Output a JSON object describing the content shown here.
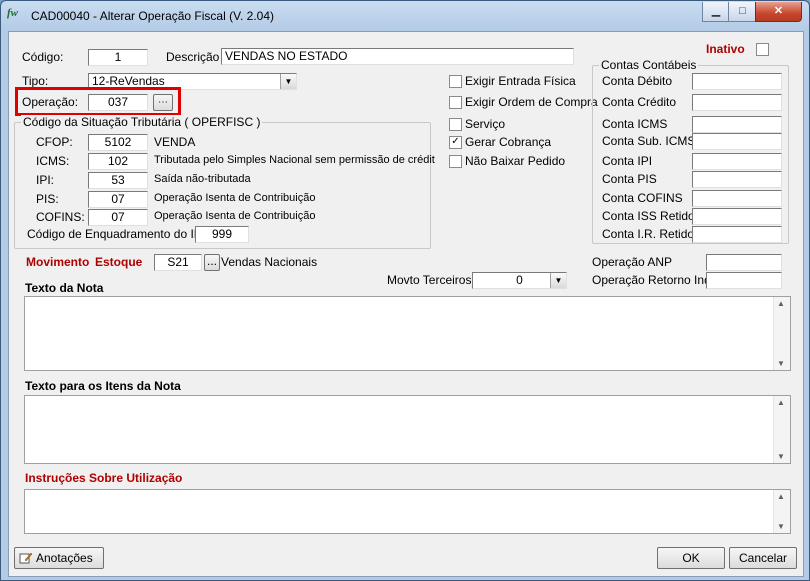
{
  "window": {
    "icon_text": "fw",
    "title": "CAD00040 - Alterar Operação Fiscal (V. 2.04)",
    "minimize": "▁",
    "maximize": "□",
    "close": "✕"
  },
  "header": {
    "codigo_label": "Código:",
    "codigo_value": "1",
    "descricao_label": "Descrição",
    "descricao_value": "VENDAS NO ESTADO",
    "inativo_label": "Inativo",
    "tipo_label": "Tipo:",
    "tipo_value": "12-ReVendas",
    "operacao_label": "Operação:",
    "operacao_value": "037",
    "operacao_btn": "⋯"
  },
  "options": {
    "exigir_entrada": "Exigir Entrada Física",
    "exigir_ordem": "Exigir Ordem de Compra",
    "servico": "Serviço",
    "gerar_cobranca": "Gerar Cobrança",
    "nao_baixar": "Não Baixar Pedido",
    "gerar_cobranca_checked": "✓"
  },
  "tributaria": {
    "title": "Código da Situação Tributária ( OPERFISC )",
    "cfop_label": "CFOP:",
    "cfop_value": "5102",
    "cfop_desc": "VENDA",
    "icms_label": "ICMS:",
    "icms_value": "102",
    "icms_desc": "Tributada pelo Simples Nacional sem permissão de crédit",
    "ipi_label": "IPI:",
    "ipi_value": "53",
    "ipi_desc": "Saída não-tributada",
    "pis_label": "PIS:",
    "pis_value": "07",
    "pis_desc": "Operação Isenta de Contribuição",
    "cofins_label": "COFINS:",
    "cofins_value": "07",
    "cofins_desc": "Operação Isenta de Contribuição",
    "enq_label": "Código de Enquadramento do IPI:",
    "enq_value": "999"
  },
  "contas": {
    "title": "Contas Contábeis",
    "debito": "Conta Débito",
    "credito": "Conta Crédito",
    "icms": "Conta ICMS",
    "sub_icms": "Conta Sub. ICMS",
    "ipi": "Conta IPI",
    "pis": "Conta PIS",
    "cofins": "Conta COFINS",
    "iss": "Conta ISS Retido",
    "ir": "Conta I.R. Retido"
  },
  "movimento": {
    "label1": "Movimento",
    "label2": "Estoque",
    "value": "S21",
    "btn": "...",
    "desc": "Vendas Nacionais",
    "terceiros_label": "Movto Terceiros",
    "terceiros_value": "0",
    "anp_label": "Operação ANP",
    "retorno_label": "Operação Retorno Ind:"
  },
  "texts": {
    "nota": "Texto da Nota",
    "itens": "Texto para os Itens da Nota",
    "instrucoes": "Instruções Sobre Utilização"
  },
  "footer": {
    "anotacoes": "Anotações",
    "ok": "OK",
    "cancelar": "Cancelar"
  }
}
